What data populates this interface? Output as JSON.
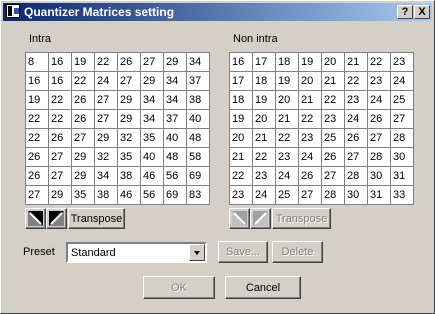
{
  "window": {
    "title": "Quantizer Matrices setting",
    "help_label": "?",
    "close_label": "X"
  },
  "intra": {
    "label": "Intra",
    "rows": [
      [
        8,
        16,
        19,
        22,
        26,
        27,
        29,
        34
      ],
      [
        16,
        16,
        22,
        24,
        27,
        29,
        34,
        37
      ],
      [
        19,
        22,
        26,
        27,
        29,
        34,
        34,
        38
      ],
      [
        22,
        22,
        26,
        27,
        29,
        34,
        37,
        40
      ],
      [
        22,
        26,
        27,
        29,
        32,
        35,
        40,
        48
      ],
      [
        26,
        27,
        29,
        32,
        35,
        40,
        48,
        58
      ],
      [
        26,
        27,
        29,
        34,
        38,
        46,
        56,
        69
      ],
      [
        27,
        29,
        35,
        38,
        46,
        56,
        69,
        83
      ]
    ],
    "transpose_label": "Transpose"
  },
  "nonintra": {
    "label": "Non intra",
    "rows": [
      [
        16,
        17,
        18,
        19,
        20,
        21,
        22,
        23
      ],
      [
        17,
        18,
        19,
        20,
        21,
        22,
        23,
        24
      ],
      [
        18,
        19,
        20,
        21,
        22,
        23,
        24,
        25
      ],
      [
        19,
        20,
        21,
        22,
        23,
        24,
        26,
        27
      ],
      [
        20,
        21,
        22,
        23,
        25,
        26,
        27,
        28
      ],
      [
        21,
        22,
        23,
        24,
        26,
        27,
        28,
        30
      ],
      [
        22,
        23,
        24,
        26,
        27,
        28,
        30,
        31
      ],
      [
        23,
        24,
        25,
        27,
        28,
        30,
        31,
        33
      ]
    ],
    "transpose_label": "Transpose"
  },
  "preset": {
    "label": "Preset",
    "selected": "Standard",
    "save_label": "Save...",
    "delete_label": "Delete"
  },
  "footer": {
    "ok_label": "OK",
    "cancel_label": "Cancel"
  }
}
